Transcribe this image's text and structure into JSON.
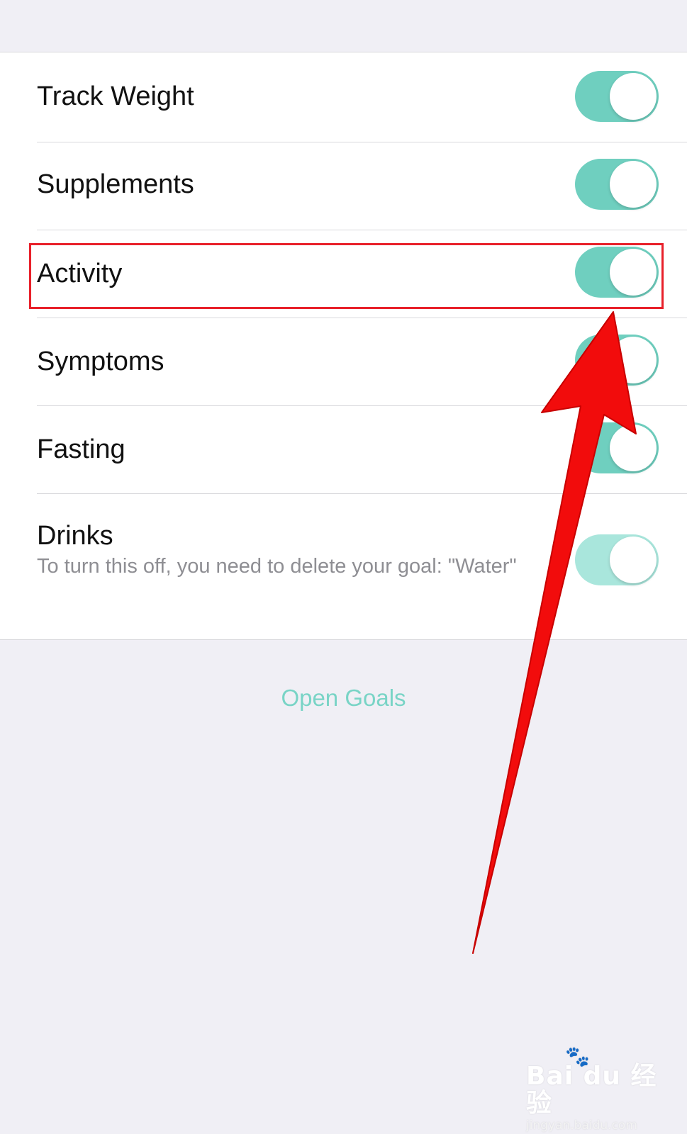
{
  "settings": {
    "rows": [
      {
        "label": "Track Weight",
        "enabled": true
      },
      {
        "label": "Supplements",
        "enabled": true
      },
      {
        "label": "Activity",
        "enabled": true
      },
      {
        "label": "Symptoms",
        "enabled": true
      },
      {
        "label": "Fasting",
        "enabled": true
      },
      {
        "label": "Drinks",
        "enabled": true,
        "locked": true,
        "sublabel": "To turn this off, you need to delete your goal: \"Water\""
      }
    ],
    "open_goals_label": "Open Goals"
  },
  "colors": {
    "toggle_on": "#6fcfbf",
    "toggle_disabled": "#a9e6dc",
    "link": "#79d4c6",
    "annotation": "#e8202a"
  },
  "watermark": {
    "brand": "Bai du 经验",
    "url": "jingyan.baidu.com"
  }
}
